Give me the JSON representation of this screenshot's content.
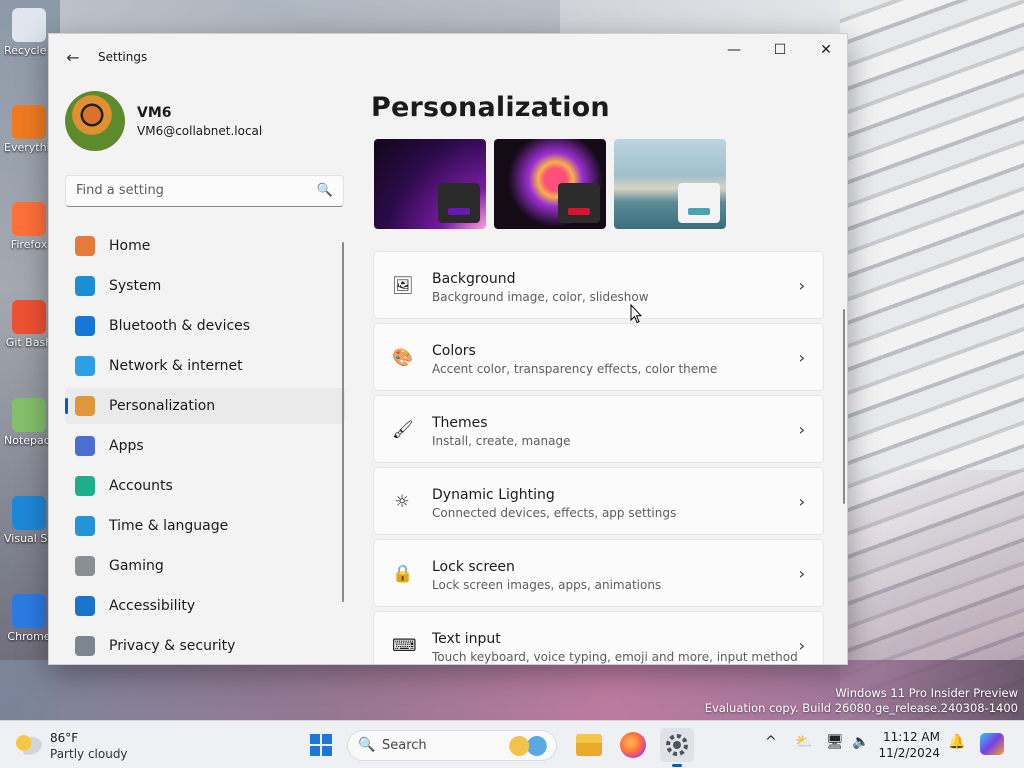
{
  "desktop": {
    "icons": [
      {
        "label": "Recycle Bin",
        "icon": "recycle-bin-icon",
        "color": "#dfe6ee"
      },
      {
        "label": "Everything",
        "icon": "search-magnifier-icon",
        "color": "#f07b22"
      },
      {
        "label": "Firefox",
        "icon": "firefox-icon",
        "color": "#ff7139"
      },
      {
        "label": "Git Bash",
        "icon": "git-icon",
        "color": "#f05133"
      },
      {
        "label": "Notepad++",
        "icon": "notepad-icon",
        "color": "#86c06b"
      },
      {
        "label": "Visual Studio Code",
        "icon": "vscode-icon",
        "color": "#1e88d8"
      },
      {
        "label": "Chrome",
        "icon": "chrome-icon",
        "color": "#2c7be5"
      }
    ]
  },
  "window": {
    "title": "Settings",
    "back_label": "←",
    "minimize": "—",
    "maximize": "☐",
    "close": "✕"
  },
  "profile": {
    "name": "VM6",
    "email": "VM6@collabnet.local"
  },
  "search": {
    "placeholder": "Find a setting",
    "icon": "🔍"
  },
  "nav": [
    {
      "label": "Home",
      "icon": "home-icon",
      "color": "#e57a3b",
      "selected": false
    },
    {
      "label": "System",
      "icon": "system-icon",
      "color": "#1b8fd6",
      "selected": false
    },
    {
      "label": "Bluetooth & devices",
      "icon": "bluetooth-icon",
      "color": "#1677d9",
      "selected": false
    },
    {
      "label": "Network & internet",
      "icon": "wifi-icon",
      "color": "#2ba0e6",
      "selected": false
    },
    {
      "label": "Personalization",
      "icon": "paintbrush-icon",
      "color": "#e0963a",
      "selected": true
    },
    {
      "label": "Apps",
      "icon": "apps-icon",
      "color": "#4a6fd0",
      "selected": false
    },
    {
      "label": "Accounts",
      "icon": "accounts-icon",
      "color": "#1fae8c",
      "selected": false
    },
    {
      "label": "Time & language",
      "icon": "globe-clock-icon",
      "color": "#2593d8",
      "selected": false
    },
    {
      "label": "Gaming",
      "icon": "gamepad-icon",
      "color": "#8a8f96",
      "selected": false
    },
    {
      "label": "Accessibility",
      "icon": "accessibility-icon",
      "color": "#1b74cc",
      "selected": false
    },
    {
      "label": "Privacy & security",
      "icon": "shield-icon",
      "color": "#7d8590",
      "selected": false
    }
  ],
  "main": {
    "heading": "Personalization",
    "themes": [
      "theme-purple-glow",
      "theme-flower",
      "theme-lake"
    ],
    "cards": [
      {
        "title": "Background",
        "desc": "Background image, color, slideshow",
        "icon": "🖼"
      },
      {
        "title": "Colors",
        "desc": "Accent color, transparency effects, color theme",
        "icon": "🎨"
      },
      {
        "title": "Themes",
        "desc": "Install, create, manage",
        "icon": "🖌"
      },
      {
        "title": "Dynamic Lighting",
        "desc": "Connected devices, effects, app settings",
        "icon": "☼"
      },
      {
        "title": "Lock screen",
        "desc": "Lock screen images, apps, animations",
        "icon": "🔒"
      },
      {
        "title": "Text input",
        "desc": "Touch keyboard, voice typing, emoji and more, input method",
        "icon": "⌨"
      }
    ],
    "chevron": "›"
  },
  "watermark": {
    "line1": "Windows 11 Pro Insider Preview",
    "line2": "Evaluation copy. Build 26080.ge_release.240308-1400"
  },
  "taskbar": {
    "weather_temp": "86°F",
    "weather_desc": "Partly cloudy",
    "search_label": "Search",
    "time": "11:12 AM",
    "date": "11/2/2024",
    "tray": [
      "^",
      "⛅",
      "🖥",
      "🔈",
      "🔔"
    ]
  },
  "colors": {
    "accent": "#005fb8",
    "window_bg": "#f3f3f3",
    "card_bg": "#fbfbfb"
  }
}
